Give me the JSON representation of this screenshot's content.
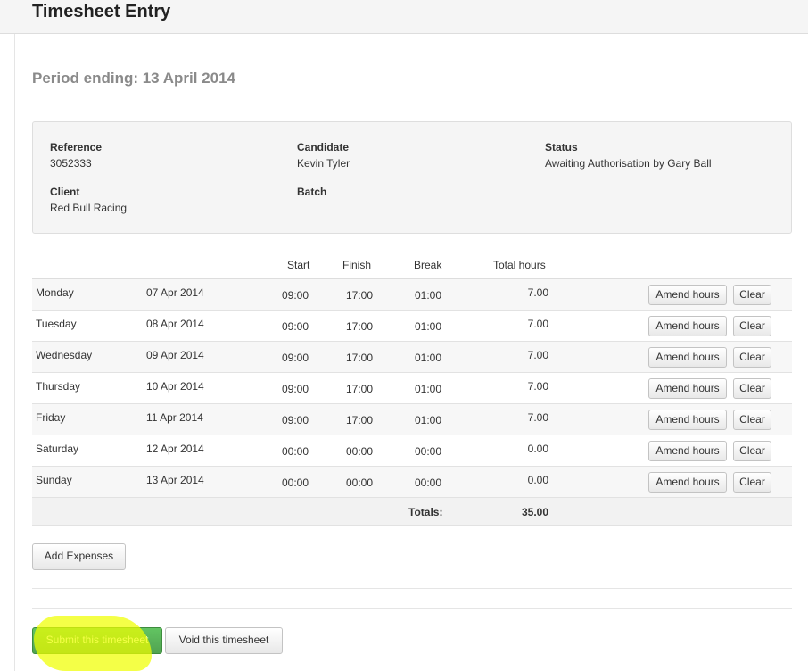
{
  "header": {
    "title": "Timesheet Entry"
  },
  "period": {
    "title": "Period ending: 13 April 2014"
  },
  "details": {
    "reference_label": "Reference",
    "reference_value": "3052333",
    "candidate_label": "Candidate",
    "candidate_value": "Kevin Tyler",
    "status_label": "Status",
    "status_value": "Awaiting Authorisation by Gary Ball",
    "client_label": "Client",
    "client_value": "Red Bull Racing",
    "batch_label": "Batch",
    "batch_value": ""
  },
  "table": {
    "headers": {
      "start": "Start",
      "finish": "Finish",
      "break": "Break",
      "total": "Total hours"
    },
    "rows": [
      {
        "day": "Monday",
        "date": "07 Apr 2014",
        "start": "09:00",
        "finish": "17:00",
        "break": "01:00",
        "total": "7.00"
      },
      {
        "day": "Tuesday",
        "date": "08 Apr 2014",
        "start": "09:00",
        "finish": "17:00",
        "break": "01:00",
        "total": "7.00"
      },
      {
        "day": "Wednesday",
        "date": "09 Apr 2014",
        "start": "09:00",
        "finish": "17:00",
        "break": "01:00",
        "total": "7.00"
      },
      {
        "day": "Thursday",
        "date": "10 Apr 2014",
        "start": "09:00",
        "finish": "17:00",
        "break": "01:00",
        "total": "7.00"
      },
      {
        "day": "Friday",
        "date": "11 Apr 2014",
        "start": "09:00",
        "finish": "17:00",
        "break": "01:00",
        "total": "7.00"
      },
      {
        "day": "Saturday",
        "date": "12 Apr 2014",
        "start": "00:00",
        "finish": "00:00",
        "break": "00:00",
        "total": "0.00"
      },
      {
        "day": "Sunday",
        "date": "13 Apr 2014",
        "start": "00:00",
        "finish": "00:00",
        "break": "00:00",
        "total": "0.00"
      }
    ],
    "amend_label": "Amend hours",
    "clear_label": "Clear",
    "totals_label": "Totals:",
    "totals_value": "35.00"
  },
  "actions": {
    "add_expenses": "Add Expenses",
    "submit": "Submit this timesheet",
    "void": "Void this timesheet"
  },
  "colors": {
    "submit_green": "#5bb75b",
    "highlight_yellow": "#f0ff00"
  }
}
